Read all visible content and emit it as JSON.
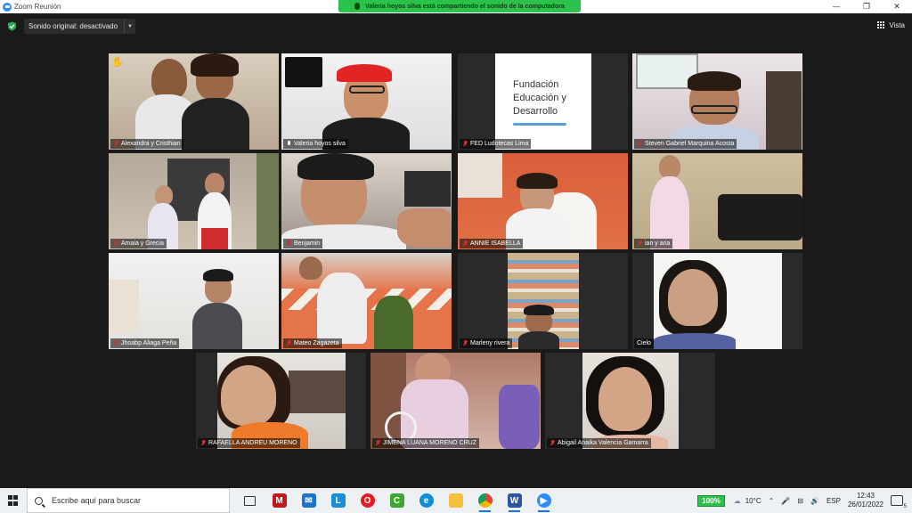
{
  "window": {
    "title": "Zoom Reunión",
    "minimize_glyph": "—",
    "restore_glyph": "❐",
    "close_glyph": "✕"
  },
  "share_banner": {
    "text": "Valeria hoyos silva está compartiendo el sonido de la computadora"
  },
  "toolbar": {
    "original_sound_label": "Sonido original: desactivado",
    "view_label": "Vista"
  },
  "participants": [
    {
      "name": "Alexandra y Cristhian",
      "muted": true,
      "raised_hand": true
    },
    {
      "name": "Valeria hoyos silva",
      "muted": false,
      "active_speaker": true
    },
    {
      "name": "FED Ludotecas Lima",
      "muted": true
    },
    {
      "name": "Steven Gabriel Marquina Acosta",
      "muted": true
    },
    {
      "name": "Amaia y Grecia",
      "muted": true
    },
    {
      "name": "Benjamin",
      "muted": true
    },
    {
      "name": "ANNIE ISABELLA",
      "muted": true
    },
    {
      "name": "ian y aria",
      "muted": true
    },
    {
      "name": "Jhoabp Aliaga Peña",
      "muted": true
    },
    {
      "name": "Mateo Zagazeta",
      "muted": true
    },
    {
      "name": "Marleny rivera",
      "muted": true
    },
    {
      "name": "Cielo",
      "muted": false
    },
    {
      "name": "RAFAELLA ANDREU MORENO",
      "muted": true
    },
    {
      "name": "JIMENA LUANA MORENO CRUZ",
      "muted": true
    },
    {
      "name": "Abigail Anaika Valencia Gamarra",
      "muted": true
    }
  ],
  "logo": {
    "line1": "Fundación",
    "line2": "Educación y",
    "line3": "Desarrollo"
  },
  "taskbar": {
    "search_placeholder": "Escribe aquí para buscar",
    "battery": "100%",
    "weather": "10°C",
    "language": "ESP",
    "time": "12:43",
    "date": "26/01/2022",
    "notification_count": "5"
  },
  "colors": {
    "active_speaker_border": "#d7e35b",
    "share_banner": "#2bc24b",
    "muted_icon": "#e02828"
  }
}
